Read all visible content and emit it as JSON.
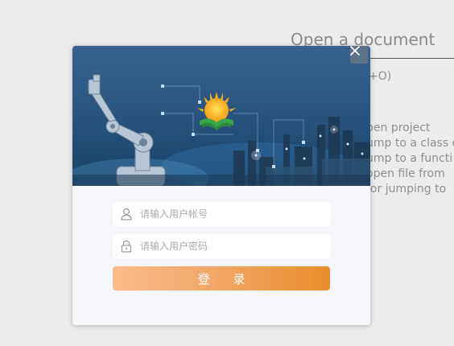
{
  "background": {
    "title": "Open a document",
    "shortcut": "+O)",
    "lines": [
      "pen project",
      "ump to a class d",
      "ump to a functi",
      "open file from",
      "for jumping to"
    ]
  },
  "dialog": {
    "close_icon": "close-icon",
    "logo": "sun-book-logo",
    "username": {
      "icon": "user-icon",
      "placeholder": "请输入用户帐号",
      "value": ""
    },
    "password": {
      "icon": "lock-icon",
      "placeholder": "请输入用户密码",
      "value": ""
    },
    "login_label": "登 录",
    "colors": {
      "button_start": "#fbbb8a",
      "button_end": "#e88d2c",
      "banner": "#2b5680",
      "panel": "#f4f6f9"
    }
  }
}
